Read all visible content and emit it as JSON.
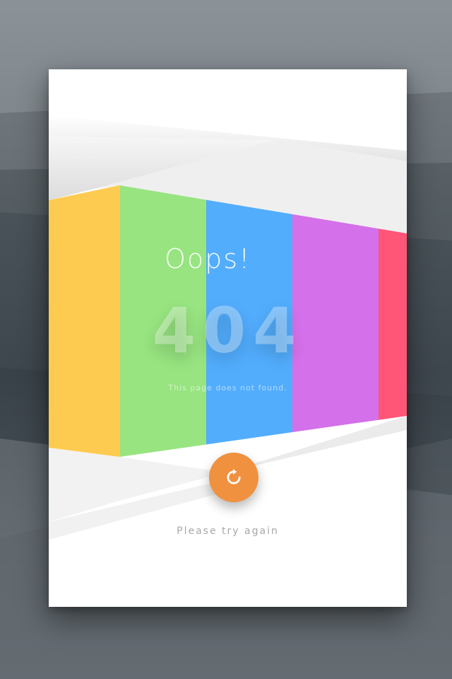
{
  "error_card": {
    "title": "Oops!",
    "code": "404",
    "message": "This page does not found.",
    "retry_hint": "Please try again"
  },
  "retry_button": {
    "icon": "refresh-icon",
    "color": "#f0913f"
  },
  "stripes": {
    "colors": [
      "#fecb51",
      "#97e480",
      "#52adfd",
      "#d470e9",
      "#ff5577"
    ]
  },
  "colors": {
    "card_background": "#ffffff",
    "page_background": "#4a5258",
    "hint_text": "#a8a8a8"
  }
}
